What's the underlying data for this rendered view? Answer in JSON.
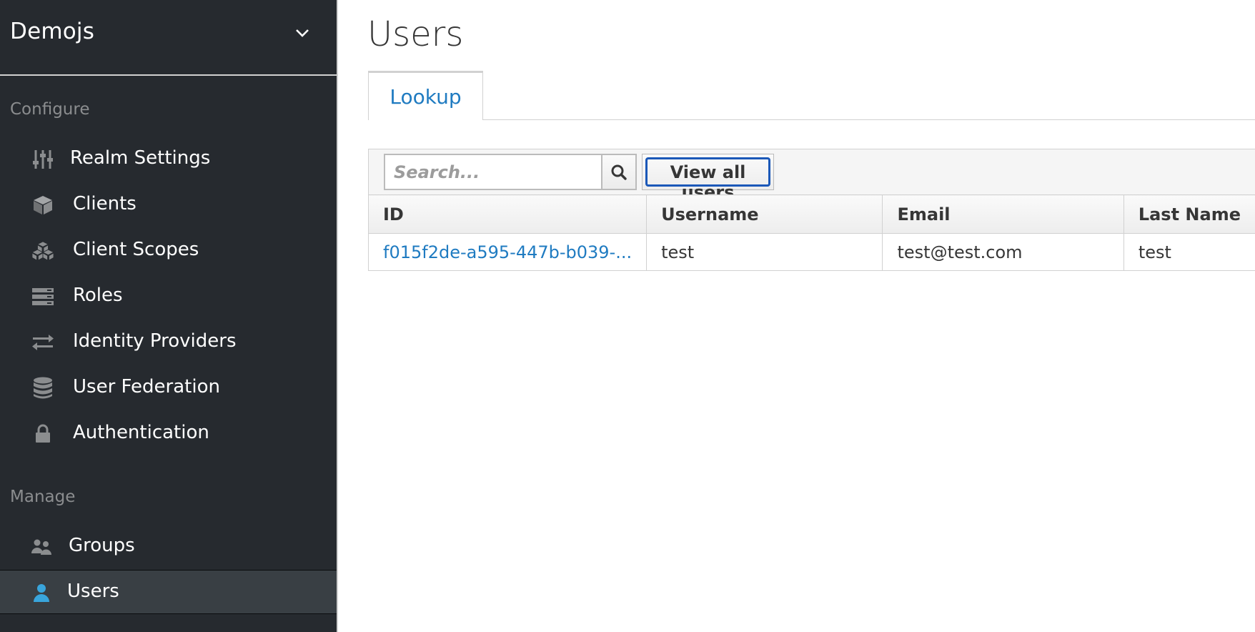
{
  "realm": {
    "name": "Demojs"
  },
  "sidebar": {
    "sections": [
      {
        "label": "Configure"
      },
      {
        "label": "Manage"
      }
    ],
    "configure_items": [
      {
        "label": "Realm Settings",
        "icon": "sliders-icon"
      },
      {
        "label": "Clients",
        "icon": "cube-icon"
      },
      {
        "label": "Client Scopes",
        "icon": "cubes-icon"
      },
      {
        "label": "Roles",
        "icon": "server-icon"
      },
      {
        "label": "Identity Providers",
        "icon": "exchange-icon"
      },
      {
        "label": "User Federation",
        "icon": "database-icon"
      },
      {
        "label": "Authentication",
        "icon": "lock-icon"
      }
    ],
    "manage_items": [
      {
        "label": "Groups",
        "icon": "users-icon"
      },
      {
        "label": "Users",
        "icon": "user-icon",
        "active": true
      }
    ]
  },
  "page": {
    "title": "Users"
  },
  "tabs": [
    {
      "label": "Lookup",
      "active": true
    }
  ],
  "toolbar": {
    "search_placeholder": "Search...",
    "search_value": "",
    "view_all_label": "View all users"
  },
  "table": {
    "columns": [
      "ID",
      "Username",
      "Email",
      "Last Name"
    ],
    "rows": [
      {
        "id": "f015f2de-a595-447b-b039-...",
        "username": "test",
        "email": "test@test.com",
        "last_name": "test"
      }
    ]
  },
  "colors": {
    "sidebar_bg": "#262a2f",
    "active_item_bg": "#393f44",
    "link": "#1f7bc1",
    "active_icon": "#39a5dc",
    "focus_ring": "#1b58b8"
  }
}
